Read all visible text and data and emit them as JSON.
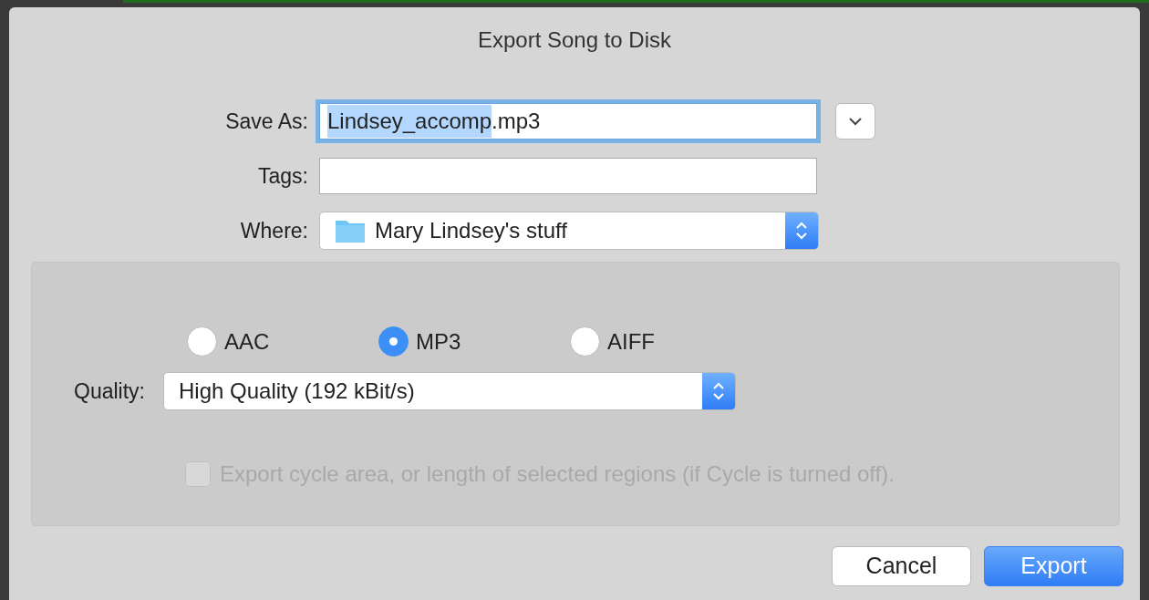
{
  "window": {
    "title": "Export Song to Disk"
  },
  "save_as": {
    "label": "Save As:",
    "value_parts": [
      {
        "text": "Lindsey_accomp",
        "selected": true
      },
      {
        "text": ".mp3",
        "selected": false
      }
    ],
    "focused": true
  },
  "tags": {
    "label": "Tags:"
  },
  "where": {
    "label": "Where:",
    "value": "Mary Lindsey's stuff"
  },
  "formats": [
    {
      "label": "AAC",
      "selected": false
    },
    {
      "label": "MP3",
      "selected": true
    },
    {
      "label": "AIFF",
      "selected": false
    }
  ],
  "quality": {
    "label": "Quality:",
    "value": "High Quality (192 kBit/s)"
  },
  "cycle_option": {
    "label": "Export cycle area, or length of selected regions (if Cycle is turned off).",
    "checked": false,
    "disabled": true
  },
  "buttons": [
    {
      "label": "Cancel",
      "kind": "secondary"
    },
    {
      "label": "Export",
      "kind": "default"
    }
  ]
}
